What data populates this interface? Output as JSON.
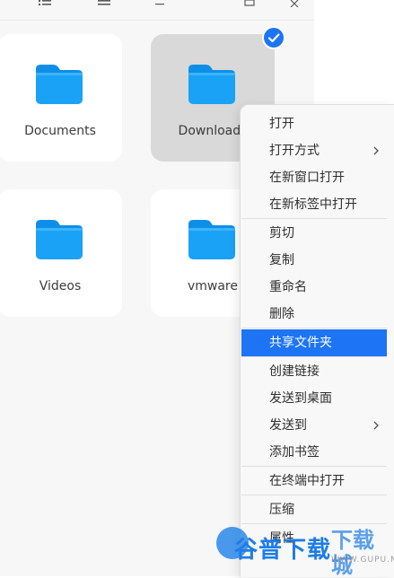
{
  "files": [
    {
      "label": "Documents",
      "selected": false,
      "icon": "folder-icon"
    },
    {
      "label": "Downloads",
      "selected": true,
      "icon": "folder-icon"
    },
    {
      "label": "Videos",
      "selected": false,
      "icon": "folder-icon"
    },
    {
      "label": "vmware",
      "selected": false,
      "icon": "folder-icon"
    }
  ],
  "context_menu": {
    "items": [
      {
        "label": "打开"
      },
      {
        "label": "打开方式",
        "submenu": true
      },
      {
        "label": "在新窗口打开"
      },
      {
        "label": "在新标签中打开"
      },
      {
        "label": "剪切"
      },
      {
        "label": "复制"
      },
      {
        "label": "重命名"
      },
      {
        "label": "删除"
      },
      {
        "label": "共享文件夹",
        "active": true
      },
      {
        "label": "创建链接"
      },
      {
        "label": "发送到桌面"
      },
      {
        "label": "发送到",
        "submenu": true
      },
      {
        "label": "添加书签"
      },
      {
        "label": "在终端中打开"
      },
      {
        "label": "压缩"
      },
      {
        "label": "属性"
      }
    ]
  },
  "watermark": {
    "main": "谷普下载",
    "secondary": "下载城",
    "url": "WWW.GUPU.NET"
  },
  "colors": {
    "accent": "#1d74f5",
    "folder_blue": "#1aa2f7",
    "selected_tile": "#d9d9d9",
    "background": "#f7f7f7"
  }
}
